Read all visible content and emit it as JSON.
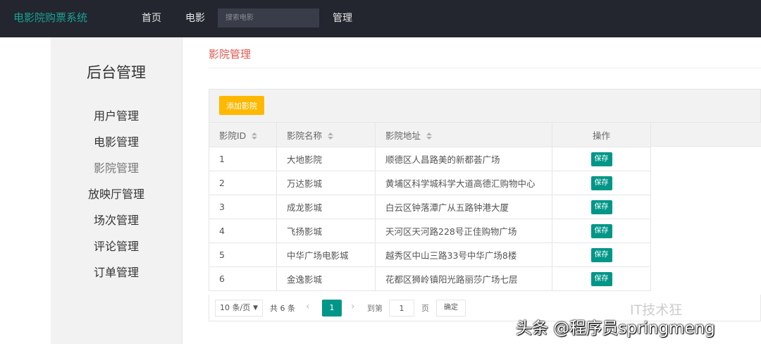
{
  "topbar": {
    "brand": "电影院购票系统",
    "nav": [
      "首页",
      "电影",
      "管理"
    ],
    "search_placeholder": "搜索电影"
  },
  "sidebar": {
    "title": "后台管理",
    "items": [
      "用户管理",
      "电影管理",
      "影院管理",
      "放映厅管理",
      "场次管理",
      "评论管理",
      "订单管理"
    ],
    "active_index": 2
  },
  "main": {
    "title": "影院管理",
    "add_button": "添加影院",
    "columns": [
      "影院ID",
      "影院名称",
      "影院地址",
      "操作"
    ],
    "rows": [
      {
        "id": "1",
        "name": "大地影院",
        "address": "顺德区人昌路美的新都荟广场",
        "action": "保存"
      },
      {
        "id": "2",
        "name": "万达影城",
        "address": "黄埔区科学城科学大道高德汇购物中心",
        "action": "保存"
      },
      {
        "id": "3",
        "name": "成龙影城",
        "address": "白云区钟落潭广从五路钟港大厦",
        "action": "保存"
      },
      {
        "id": "4",
        "name": "飞扬影城",
        "address": "天河区天河路228号正佳购物广场",
        "action": "保存"
      },
      {
        "id": "5",
        "name": "中华广场电影城",
        "address": "越秀区中山三路33号中华广场8楼",
        "action": "保存"
      },
      {
        "id": "6",
        "name": "金逸影城",
        "address": "花都区狮岭镇阳光路丽莎广场七层",
        "action": "保存"
      }
    ]
  },
  "pager": {
    "limit": "10 条/页",
    "total": "共 6 条",
    "current": "1",
    "goto_label": "到第",
    "goto_value": "1",
    "page_unit": "页",
    "confirm": "确定"
  },
  "watermark": {
    "top": "IT技术狂",
    "bottom": "头条 @程序员springmeng"
  },
  "colors": {
    "accent": "#009688",
    "warning": "#ffb800",
    "title_red": "#e0574e",
    "topbar": "#23262e"
  }
}
